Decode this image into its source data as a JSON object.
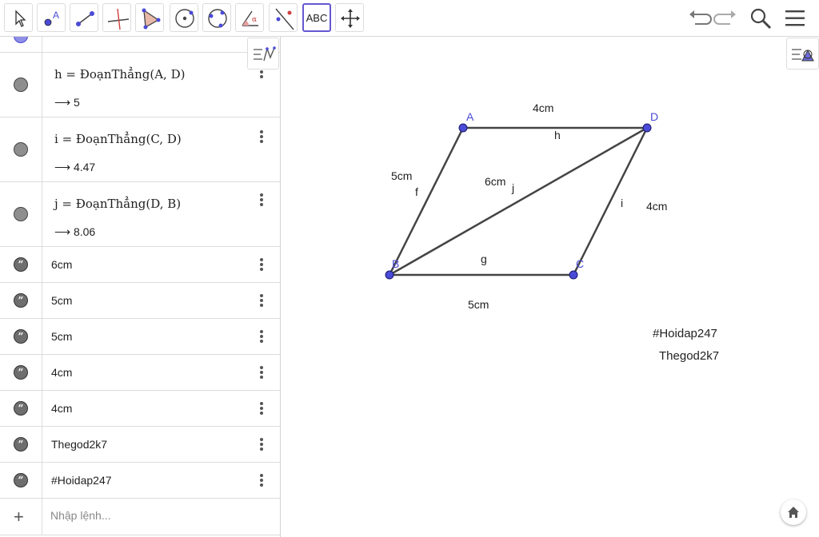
{
  "toolbar": {
    "tools": [
      {
        "name": "move-tool"
      },
      {
        "name": "point-tool",
        "glyph": "A"
      },
      {
        "name": "segment-tool"
      },
      {
        "name": "perpendicular-line-tool"
      },
      {
        "name": "polygon-tool"
      },
      {
        "name": "circle-center-tool"
      },
      {
        "name": "circle-three-points-tool"
      },
      {
        "name": "angle-tool",
        "glyph": "α"
      },
      {
        "name": "reflect-tool"
      },
      {
        "name": "text-tool",
        "label": "ABC"
      },
      {
        "name": "move-graphics-view-tool"
      }
    ],
    "right": [
      "undo-icon",
      "redo-icon",
      "search-icon",
      "menu-icon"
    ]
  },
  "algebra": {
    "rows": [
      {
        "kind": "def",
        "name": "h",
        "definition": "h = ĐoạnThẳng(A, D)",
        "value": "⟶ 5"
      },
      {
        "kind": "def",
        "name": "i",
        "definition": "i = ĐoạnThẳng(C, D)",
        "value": "⟶ 4.47"
      },
      {
        "kind": "def",
        "name": "j",
        "definition": "j = ĐoạnThẳng(D, B)",
        "value": "⟶ 8.06"
      },
      {
        "kind": "text",
        "text": "6cm"
      },
      {
        "kind": "text",
        "text": "5cm"
      },
      {
        "kind": "text",
        "text": "5cm"
      },
      {
        "kind": "text",
        "text": "4cm"
      },
      {
        "kind": "text",
        "text": "4cm"
      },
      {
        "kind": "text",
        "text": "Thegod2k7"
      },
      {
        "kind": "text",
        "text": "#Hoidap247"
      }
    ],
    "input_placeholder": "Nhập lệnh..."
  },
  "graphics": {
    "point_color": "#4a4ad6",
    "segment_color": "#444444",
    "points": {
      "A": "A",
      "B": "B",
      "C": "C",
      "D": "D"
    },
    "segment_labels": {
      "f": "f",
      "g": "g",
      "h": "h",
      "i": "i",
      "j": "j"
    },
    "length_labels": {
      "top": "4cm",
      "left": "5cm",
      "diagonal": "6cm",
      "right": "4cm",
      "bottom": "5cm"
    },
    "texts": {
      "hashtag": "#Hoidap247",
      "author": "Thegod2k7"
    }
  }
}
